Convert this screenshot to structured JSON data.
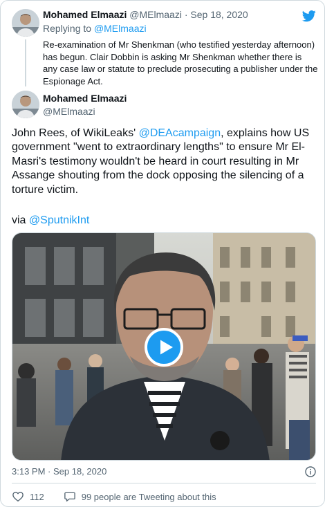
{
  "parent": {
    "name": "Mohamed Elmaazi",
    "handle": "@MElmaazi",
    "separator": "·",
    "date": "Sep 18, 2020",
    "replying_label": "Replying to",
    "replying_handle": "@MElmaazi",
    "text": "Re-examination of Mr Shenkman (who testified yesterday afternoon) has begun. Clair Dobbin is asking Mr Shenkman whether there is any case law or statute to preclude prosecuting a publisher under the Espionage Act."
  },
  "tweet": {
    "name": "Mohamed Elmaazi",
    "handle": "@MElmaazi",
    "text_before_mention": "John Rees, of WikiLeaks' ",
    "mention": "@DEAcampaign",
    "text_after_mention": ", explains how US government \"went to extraordinary lengths\" to ensure Mr El-Masri's testimony wouldn't be heard in court resulting in Mr Assange shouting from the dock opposing the silencing of a torture victim.",
    "via_label": "via ",
    "via_handle": "@SputnikInt",
    "time": "3:13 PM · Sep 18, 2020"
  },
  "actions": {
    "likes": "112",
    "tweeting": "99 people are Tweeting about this"
  },
  "icons": {
    "brand": "twitter-bird-icon",
    "play": "play-icon",
    "info": "info-icon",
    "like": "heart-icon",
    "reply": "speech-bubble-icon"
  },
  "colors": {
    "accent": "#1d9bf0",
    "text": "#0f1419",
    "secondary": "#536471",
    "border": "#cfd9de"
  }
}
